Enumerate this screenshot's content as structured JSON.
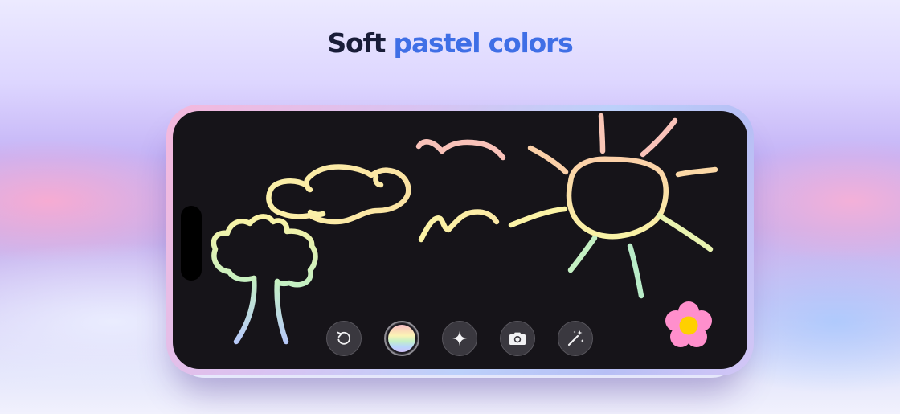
{
  "headline": {
    "text_dark": "Soft",
    "text_accent": "pastel colors"
  },
  "colors": {
    "accent": "#3f6fe6",
    "headline_dark": "#191d38",
    "canvas": "#161419",
    "toolbar_button": "#3a383f",
    "flower_petals": "#ff8fcc",
    "flower_center": "#ffd000"
  },
  "toolbar": {
    "buttons": [
      {
        "name": "undo",
        "icon": "undo-arrow-icon"
      },
      {
        "name": "color-picker",
        "icon": "rainbow-swatch-icon",
        "selected": true
      },
      {
        "name": "sparkle",
        "icon": "sparkle-icon"
      },
      {
        "name": "camera",
        "icon": "camera-icon"
      },
      {
        "name": "magic",
        "icon": "magic-wand-icon"
      }
    ]
  },
  "drawing": {
    "subjects": [
      "tree",
      "cloud",
      "birds",
      "sun"
    ],
    "palette": [
      "#fbd8a6",
      "#fbf3a5",
      "#c4f0c3",
      "#b7c9f8",
      "#f9c2b9",
      "#fbe3a3"
    ]
  },
  "stamp": {
    "icon": "flower-icon"
  }
}
